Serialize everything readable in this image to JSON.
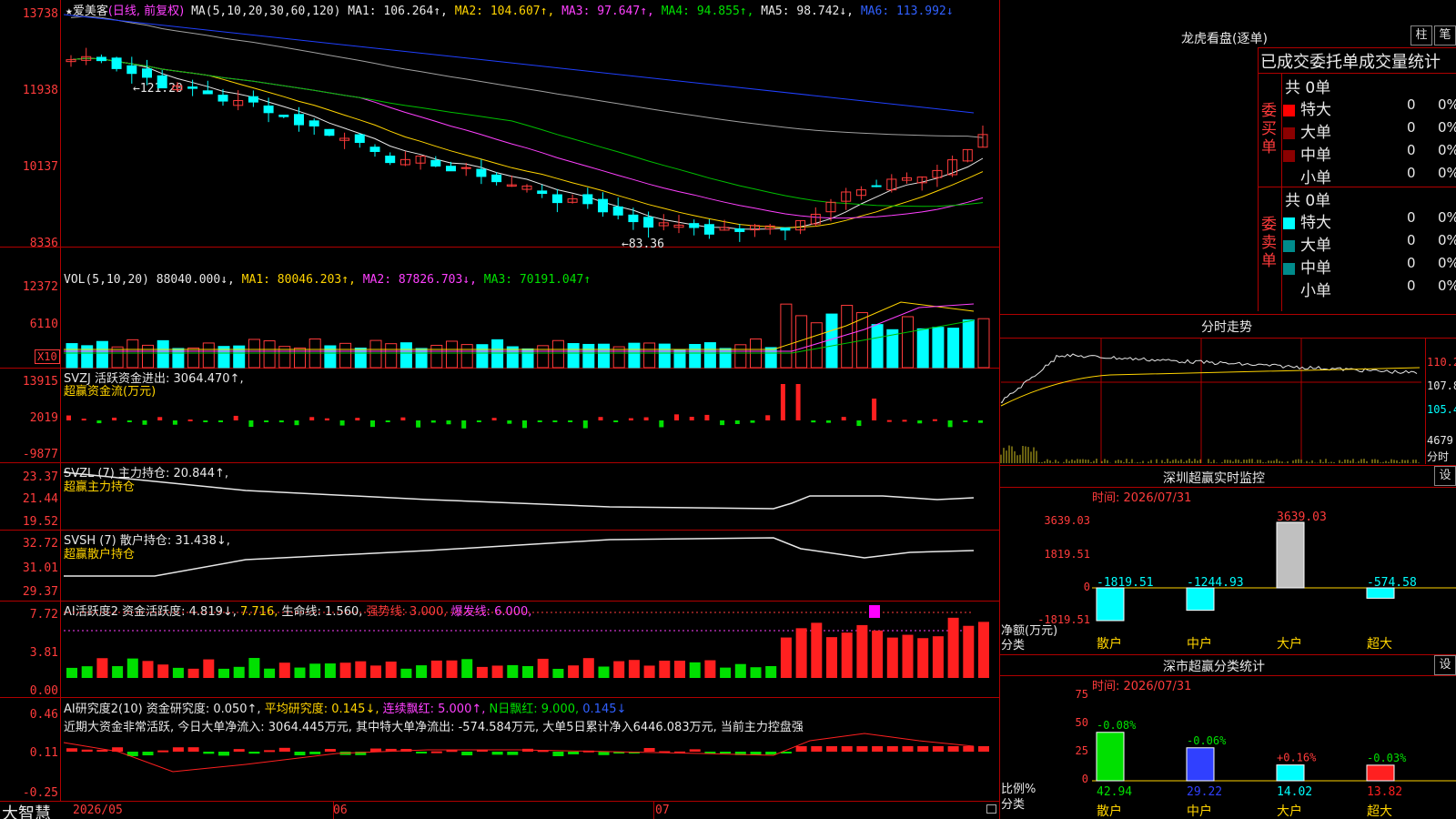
{
  "main_chart": {
    "header_star": "★",
    "stock_name": "爱美客",
    "period": "(日线, 前复权)",
    "ma_label": "MA(5,10,20,30,60,120)",
    "ma1": "MA1: 106.264↑,",
    "ma2": "MA2: 104.607↑,",
    "ma3": "MA3: 97.647↑,",
    "ma4": "MA4: 94.855↑,",
    "ma5": "MA5: 98.742↓,",
    "ma6": "MA6: 113.992↓",
    "y_ticks": [
      "13738",
      "11938",
      "10137",
      "8336"
    ],
    "high_note": "←121.20",
    "low_note": "←83.36"
  },
  "vol_chart": {
    "label": "VOL(5,10,20)",
    "value": "88040.000↓,",
    "ma1": "MA1: 80046.203↑,",
    "ma2": "MA2: 87826.703↓,",
    "ma3": "MA3: 70191.047↑",
    "y_ticks": [
      "12372",
      "6110"
    ],
    "multiplier": "X10"
  },
  "svzj": {
    "label": "SVZJ  活跃资金进出: 3064.470↑,",
    "subtitle": "超赢资金流(万元)",
    "y_ticks": [
      "13915",
      "2019",
      "-9877"
    ]
  },
  "svzl": {
    "label": "SVZL (7) 主力持仓: 20.844↑,",
    "subtitle": "超赢主力持仓",
    "y_ticks": [
      "23.37",
      "21.44",
      "19.52"
    ]
  },
  "svsh": {
    "label": "SVSH (7) 散户持仓: 31.438↓,",
    "subtitle": "超赢散户持仓",
    "y_ticks": [
      "32.72",
      "31.01",
      "29.37"
    ]
  },
  "ai_active": {
    "label_a": "AI活跃度2 资金活跃度: 4.819↓,",
    "label_b": "7.716,",
    "label_c": "生命线: 1.560,",
    "label_d": "强势线: 3.000,",
    "label_e": "爆发线: 6.000,",
    "y_ticks": [
      "7.72",
      "3.81",
      "0.00"
    ]
  },
  "ai_research": {
    "label_a": "AI研究度2(10) 资金研究度: 0.050↑,",
    "label_b": "平均研究度: 0.145↓,",
    "label_c": "连续飘红: 5.000↑,",
    "label_d": "N日飘红: 9.000,",
    "label_e": "0.145↓",
    "summary": "近期大资金非常活跃, 今日大单净流入: 3064.445万元, 其中特大单净流出: -574.584万元, 大单5日累计净入6446.083万元, 当前主力控盘强",
    "y_ticks": [
      "0.46",
      "0.11",
      "-0.25"
    ]
  },
  "bottom_axis": {
    "brand": "大智慧",
    "dates": [
      "2026/05",
      "06",
      "07"
    ]
  },
  "dragon_tiger": {
    "title": "龙虎看盘(逐单)",
    "btn_bar": "柱",
    "btn_pen": "笔",
    "subtitle": "已成交委托单成交量统计",
    "buy_side": "委买单",
    "sell_side": "委卖单",
    "buy_total": "共 0单",
    "sell_total": "共 0单",
    "buy_rows": [
      {
        "label": "特大",
        "count": "0",
        "pct": "0%",
        "color": "#ff0000"
      },
      {
        "label": "大单",
        "count": "0",
        "pct": "0%",
        "color": "#8b0000"
      },
      {
        "label": "中单",
        "count": "0",
        "pct": "0%",
        "color": "#8b0000"
      },
      {
        "label": "小单",
        "count": "0",
        "pct": "0%",
        "color": ""
      }
    ],
    "sell_rows": [
      {
        "label": "特大",
        "count": "0",
        "pct": "0%",
        "color": "#00ffff"
      },
      {
        "label": "大单",
        "count": "0",
        "pct": "0%",
        "color": "#008b8b"
      },
      {
        "label": "中单",
        "count": "0",
        "pct": "0%",
        "color": "#008b8b"
      },
      {
        "label": "小单",
        "count": "0",
        "pct": "0%",
        "color": ""
      }
    ]
  },
  "intraday": {
    "title": "分时走势",
    "y_ticks": [
      "110.2",
      "107.8",
      "105.4"
    ],
    "vol_tick": "4679",
    "vol_label": "分时"
  },
  "sz_monitor": {
    "title": "深圳超赢实时监控",
    "btn": "设",
    "date": "时间: 2026/07/31",
    "y_ticks": [
      "3639.03",
      "1819.51",
      "0",
      "-1819.51"
    ],
    "unit": "净额(万元)",
    "category_label": "分类",
    "bars": [
      {
        "name": "散户",
        "value": -1819.51,
        "label": "-1819.51"
      },
      {
        "name": "中户",
        "value": -1244.93,
        "label": "-1244.93"
      },
      {
        "name": "大户",
        "value": 3639.03,
        "label": "3639.03"
      },
      {
        "name": "超大",
        "value": -574.58,
        "label": "-574.58"
      }
    ]
  },
  "sz_category": {
    "title": "深市超赢分类统计",
    "btn": "设",
    "date": "时间: 2026/07/31",
    "y_ticks": [
      "75",
      "50",
      "25",
      "0"
    ],
    "unit": "比例%",
    "category_label": "分类",
    "bars": [
      {
        "name": "散户",
        "value": 42.94,
        "change": "-0.08%"
      },
      {
        "name": "中户",
        "value": 29.22,
        "change": "-0.06%"
      },
      {
        "name": "大户",
        "value": 14.02,
        "change": "+0.16%"
      },
      {
        "name": "超大",
        "value": 13.82,
        "change": "-0.03%"
      }
    ]
  }
}
